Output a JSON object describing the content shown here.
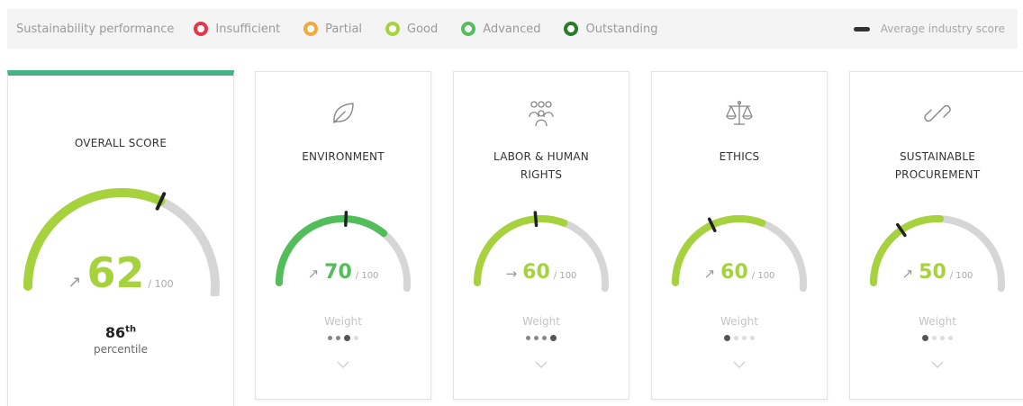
{
  "legend": {
    "title": "Sustainability performance",
    "items": [
      {
        "label": "Insufficient",
        "color": "#e8344a"
      },
      {
        "label": "Partial",
        "color": "#f3a93a"
      },
      {
        "label": "Good",
        "color": "#a6d33d"
      },
      {
        "label": "Advanced",
        "color": "#52be5a"
      },
      {
        "label": "Outstanding",
        "color": "#2a7a2a"
      }
    ],
    "average_label": "Average industry score"
  },
  "overall": {
    "title": "OVERALL SCORE",
    "arrow": "↗",
    "score": "62",
    "max": "/ 100",
    "value": 62,
    "industry_average": 62,
    "color": "#a6d33d",
    "percentile_num": "86",
    "percentile_suffix": "th",
    "percentile_label": "percentile"
  },
  "categories": [
    {
      "key": "environment",
      "icon": "leaf-icon",
      "title_lines": [
        "ENVIRONMENT"
      ],
      "arrow": "↗",
      "score": "70",
      "max": "/ 100",
      "value": 70,
      "industry_average": 50,
      "color": "#52be5a",
      "weight_label": "Weight",
      "weight_level": 3
    },
    {
      "key": "labor",
      "icon": "people-icon",
      "title_lines": [
        "LABOR & HUMAN",
        "RIGHTS"
      ],
      "arrow": "→",
      "score": "60",
      "max": "/ 100",
      "value": 60,
      "industry_average": 46,
      "color": "#a6d33d",
      "weight_label": "Weight",
      "weight_level": 4
    },
    {
      "key": "ethics",
      "icon": "scales-icon",
      "title_lines": [
        "ETHICS"
      ],
      "arrow": "↗",
      "score": "60",
      "max": "/ 100",
      "value": 60,
      "industry_average": 35,
      "color": "#a6d33d",
      "weight_label": "Weight",
      "weight_level": 1
    },
    {
      "key": "procurement",
      "icon": "link-icon",
      "title_lines": [
        "SUSTAINABLE",
        "PROCUREMENT"
      ],
      "arrow": "↗",
      "score": "50",
      "max": "/ 100",
      "value": 50,
      "industry_average": 30,
      "color": "#a6d33d",
      "weight_label": "Weight",
      "weight_level": 1
    }
  ]
}
